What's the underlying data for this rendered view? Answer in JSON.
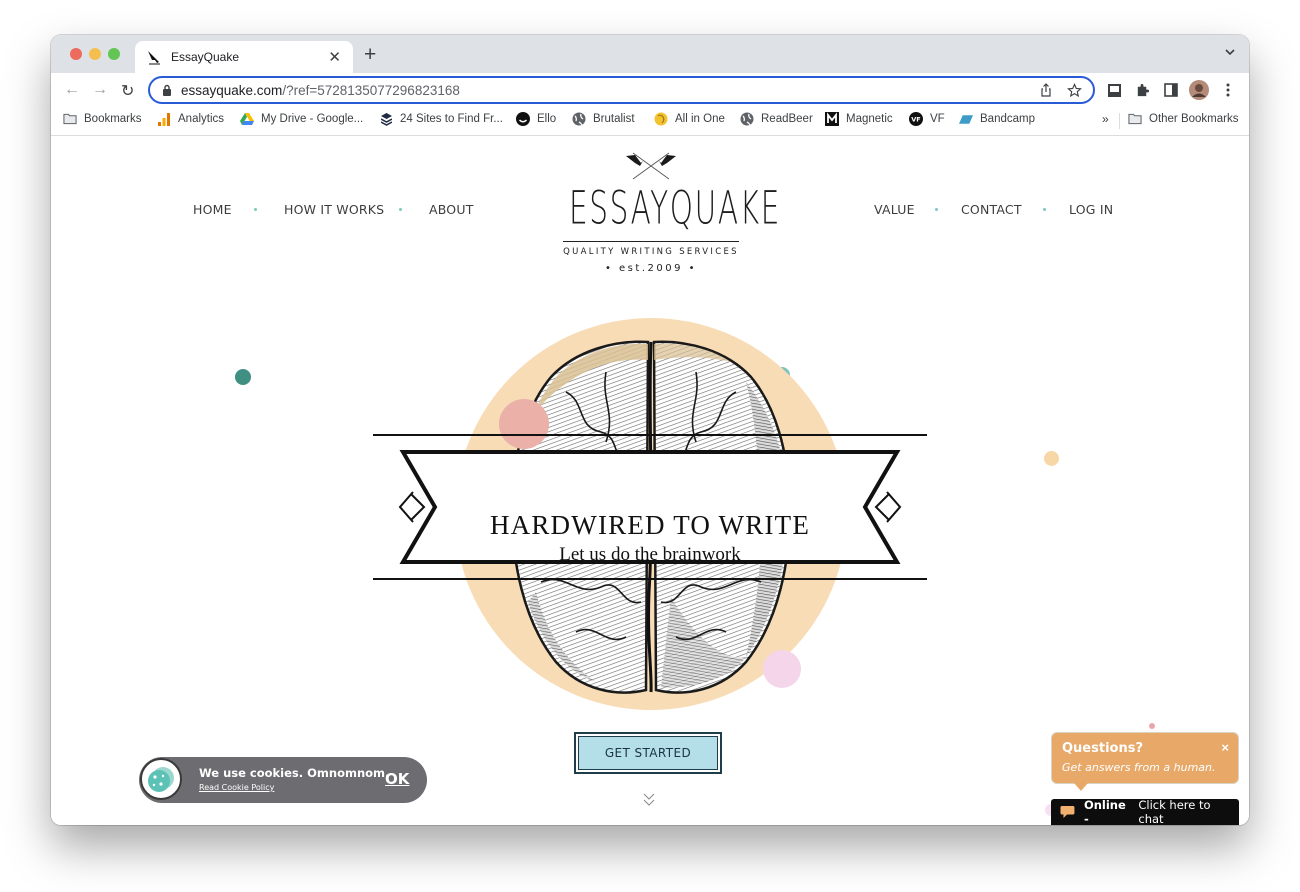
{
  "browser": {
    "tab_title": "EssayQuake",
    "url_host": "essayquake.com",
    "url_path": "/?ref=5728135077296823168",
    "bookmarks": [
      {
        "label": "Bookmarks",
        "icon": "folder-icon"
      },
      {
        "label": "Analytics",
        "icon": "analytics-icon"
      },
      {
        "label": "My Drive - Google...",
        "icon": "google-drive-icon"
      },
      {
        "label": "24 Sites to Find Fr...",
        "icon": "layers-icon"
      },
      {
        "label": "Ello",
        "icon": "ello-icon"
      },
      {
        "label": "Brutalist",
        "icon": "globe-icon"
      },
      {
        "label": "All in One",
        "icon": "all-in-one-icon"
      },
      {
        "label": "ReadBeer",
        "icon": "globe-icon"
      },
      {
        "label": "Magnetic",
        "icon": "magnetic-icon"
      },
      {
        "label": "VF",
        "icon": "vf-icon"
      },
      {
        "label": "Bandcamp",
        "icon": "bandcamp-icon"
      }
    ],
    "overflow_label": "»",
    "other_bookmarks": "Other Bookmarks"
  },
  "site": {
    "nav_left": [
      "HOME",
      "HOW IT WORKS",
      "ABOUT"
    ],
    "nav_right": [
      "VALUE",
      "CONTACT",
      "LOG IN"
    ],
    "logo": {
      "wordmark": "ESSAYQUAKE",
      "tagline": "QUALITY WRITING SERVICES",
      "est": "• est.2009 •"
    },
    "hero": {
      "title": "HARDWIRED TO WRITE",
      "subtitle": "Let us do the brainwork",
      "cta": "GET STARTED"
    },
    "colors": {
      "accent_teal": "#4a9a90",
      "hero_circle": "#f7dcb6",
      "cta_bg": "#b4dfe9",
      "chat_orange": "#e8a868"
    }
  },
  "cookie": {
    "message": "We use cookies. Omnomnom.",
    "link": "Read Cookie Policy",
    "ok": "OK"
  },
  "chat": {
    "title": "Questions?",
    "subtitle": "Get answers from a human.",
    "close": "×",
    "status": "Online -",
    "action": "Click here to chat"
  }
}
